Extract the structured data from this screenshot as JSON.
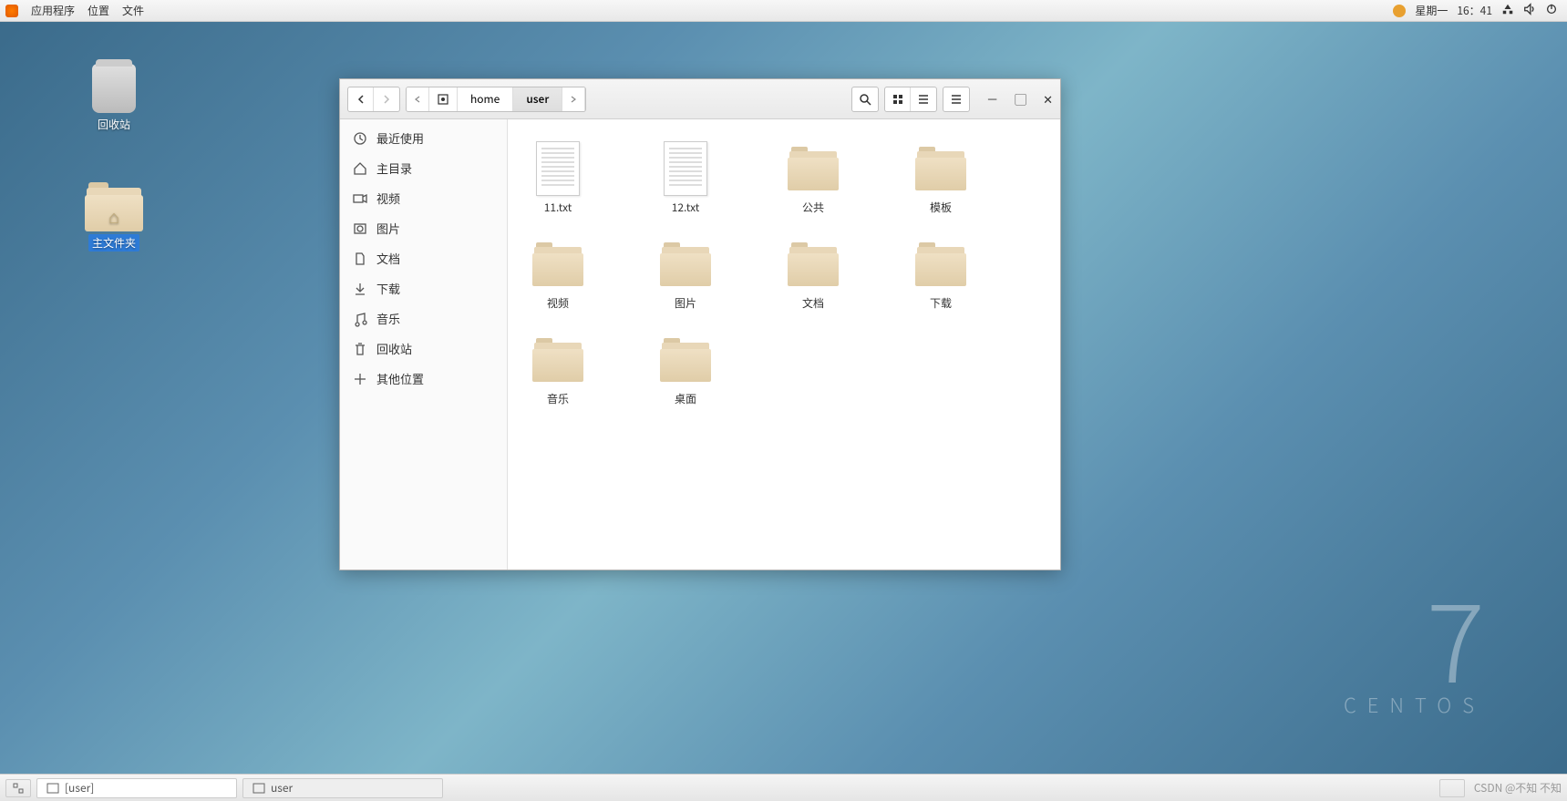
{
  "top_panel": {
    "menus": [
      "应用程序",
      "位置",
      "文件"
    ],
    "day": "星期一",
    "time": "16：41"
  },
  "desktop": {
    "trash": {
      "label": "回收站"
    },
    "home": {
      "label": "主文件夹"
    }
  },
  "fm": {
    "breadcrumb": [
      "home",
      "user"
    ],
    "sidebar": [
      {
        "id": "recent",
        "label": "最近使用"
      },
      {
        "id": "home",
        "label": "主目录"
      },
      {
        "id": "video",
        "label": "视频"
      },
      {
        "id": "pictures",
        "label": "图片"
      },
      {
        "id": "documents",
        "label": "文档"
      },
      {
        "id": "downloads",
        "label": "下载"
      },
      {
        "id": "music",
        "label": "音乐"
      },
      {
        "id": "trash",
        "label": "回收站"
      },
      {
        "id": "other",
        "label": "其他位置"
      }
    ],
    "files": [
      {
        "name": "11.txt",
        "type": "text"
      },
      {
        "name": "12.txt",
        "type": "text"
      },
      {
        "name": "公共",
        "type": "folder"
      },
      {
        "name": "模板",
        "type": "folder"
      },
      {
        "name": "视频",
        "type": "folder"
      },
      {
        "name": "图片",
        "type": "folder"
      },
      {
        "name": "文档",
        "type": "folder"
      },
      {
        "name": "下载",
        "type": "folder"
      },
      {
        "name": "音乐",
        "type": "folder"
      },
      {
        "name": "桌面",
        "type": "folder"
      }
    ]
  },
  "taskbar": {
    "items": [
      {
        "label": "[user]",
        "active": false
      },
      {
        "label": "user",
        "active": true
      }
    ]
  },
  "watermark": {
    "num": "7",
    "text": "CENTOS"
  },
  "footer_credit": "CSDN @不知 不知"
}
